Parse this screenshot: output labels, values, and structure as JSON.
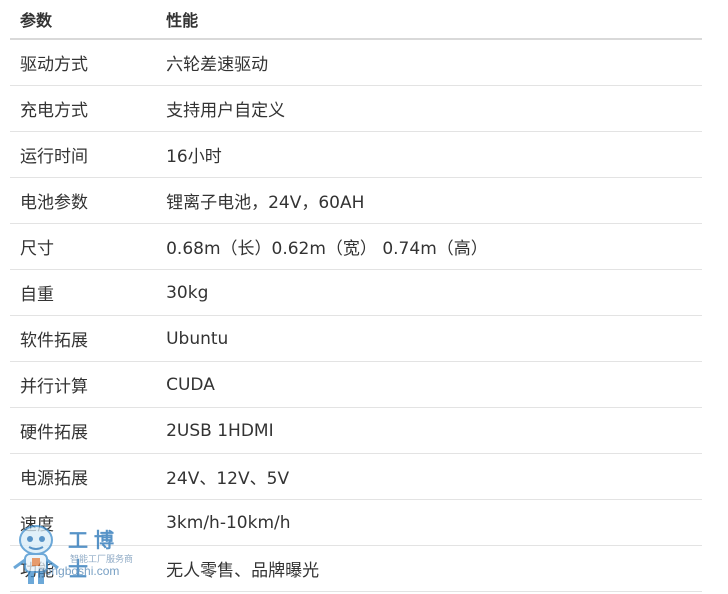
{
  "table": {
    "headers": {
      "param": "参数",
      "value": "性能"
    },
    "rows": [
      {
        "param": "驱动方式",
        "value": "六轮差速驱动"
      },
      {
        "param": "充电方式",
        "value": "支持用户自定义"
      },
      {
        "param": "运行时间",
        "value": "16小时"
      },
      {
        "param": "电池参数",
        "value": "锂离子电池，24V，60AH"
      },
      {
        "param": "尺寸",
        "value": "0.68m（长）0.62m（宽）  0.74m（高）"
      },
      {
        "param": "自重",
        "value": "30kg"
      },
      {
        "param": "软件拓展",
        "value": "Ubuntu"
      },
      {
        "param": "并行计算",
        "value": "CUDA"
      },
      {
        "param": "硬件拓展",
        "value": "2USB 1HDMI"
      },
      {
        "param": "电源拓展",
        "value": "24V、12V、5V"
      },
      {
        "param": "速度",
        "value": "3km/h-10km/h"
      },
      {
        "param": "功能",
        "value": "无人零售、品牌曝光"
      }
    ]
  },
  "watermark": {
    "brand": "工博士",
    "slogan": "智能工厂服务商",
    "url": "gongboshi.com"
  }
}
